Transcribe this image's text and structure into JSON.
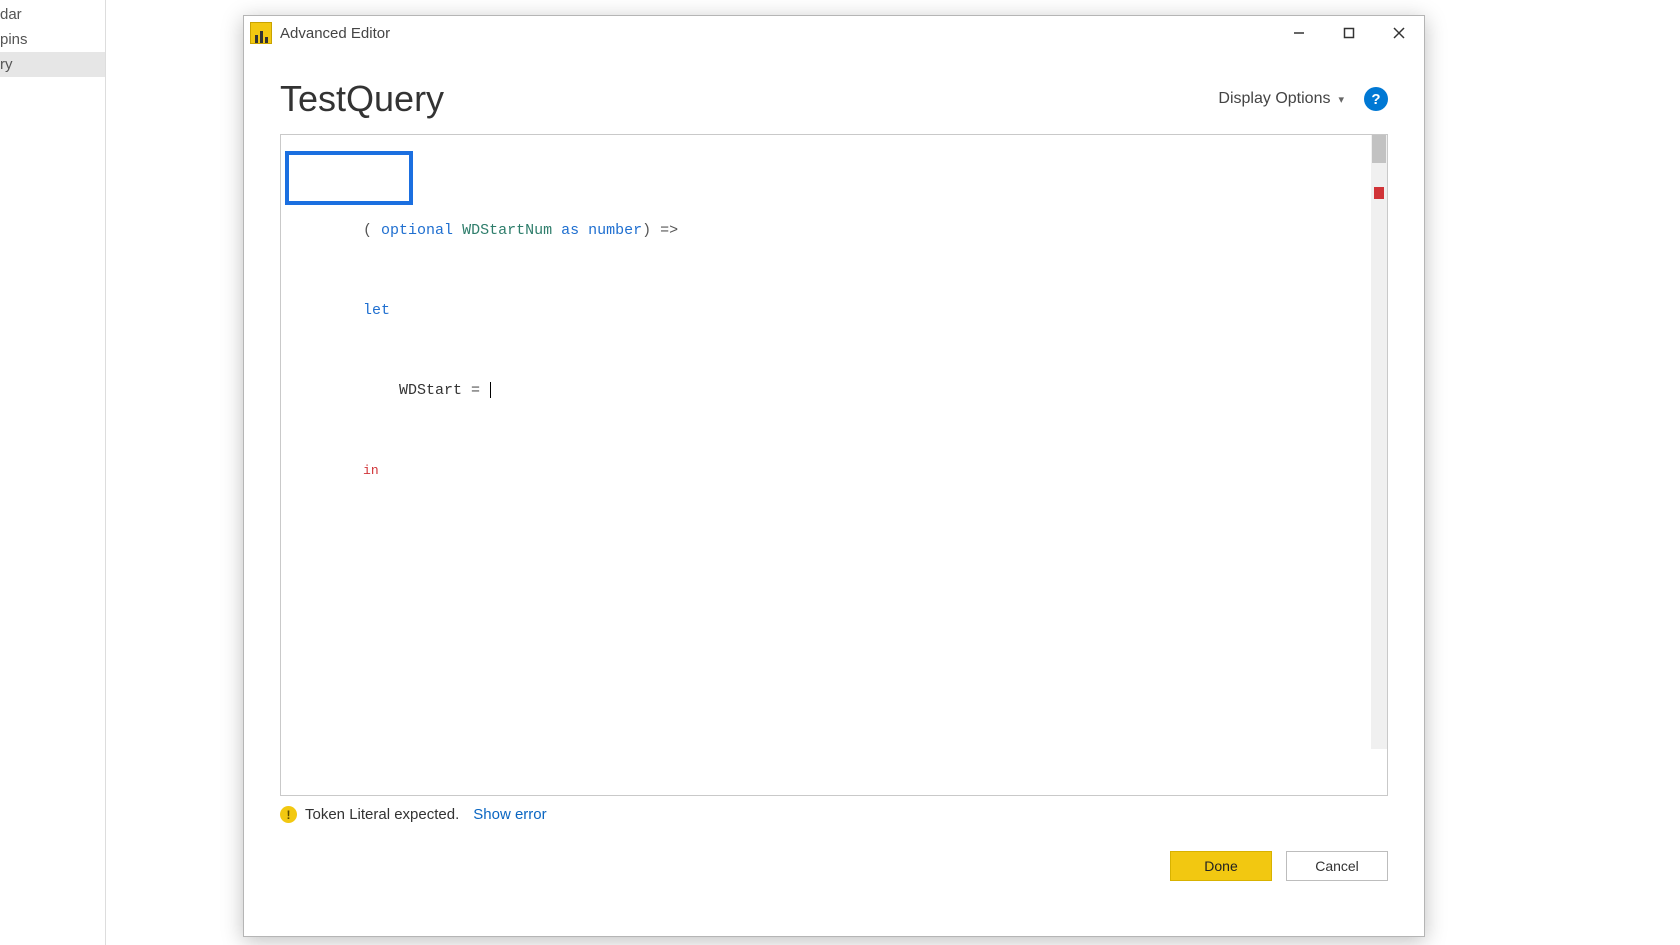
{
  "sidebar": {
    "items": [
      {
        "label": "dar"
      },
      {
        "label": "pins"
      },
      {
        "label": "ry"
      }
    ],
    "selected_index": 2
  },
  "window": {
    "title": "Advanced Editor"
  },
  "header": {
    "query_name": "TestQuery",
    "display_options_label": "Display Options"
  },
  "code": {
    "line1_prefix": "( ",
    "line1_kw1": "optional",
    "line1_id": "WDStartNum",
    "line1_kw2": "as",
    "line1_type": "number",
    "line1_suffix": ") =>",
    "line2_kw": "let",
    "line3_indent": "    ",
    "line3_id": "WDStart",
    "line3_op": " = ",
    "line4_err": "in"
  },
  "status": {
    "message": "Token Literal expected.",
    "show_error_label": "Show error"
  },
  "footer": {
    "done_label": "Done",
    "cancel_label": "Cancel"
  }
}
